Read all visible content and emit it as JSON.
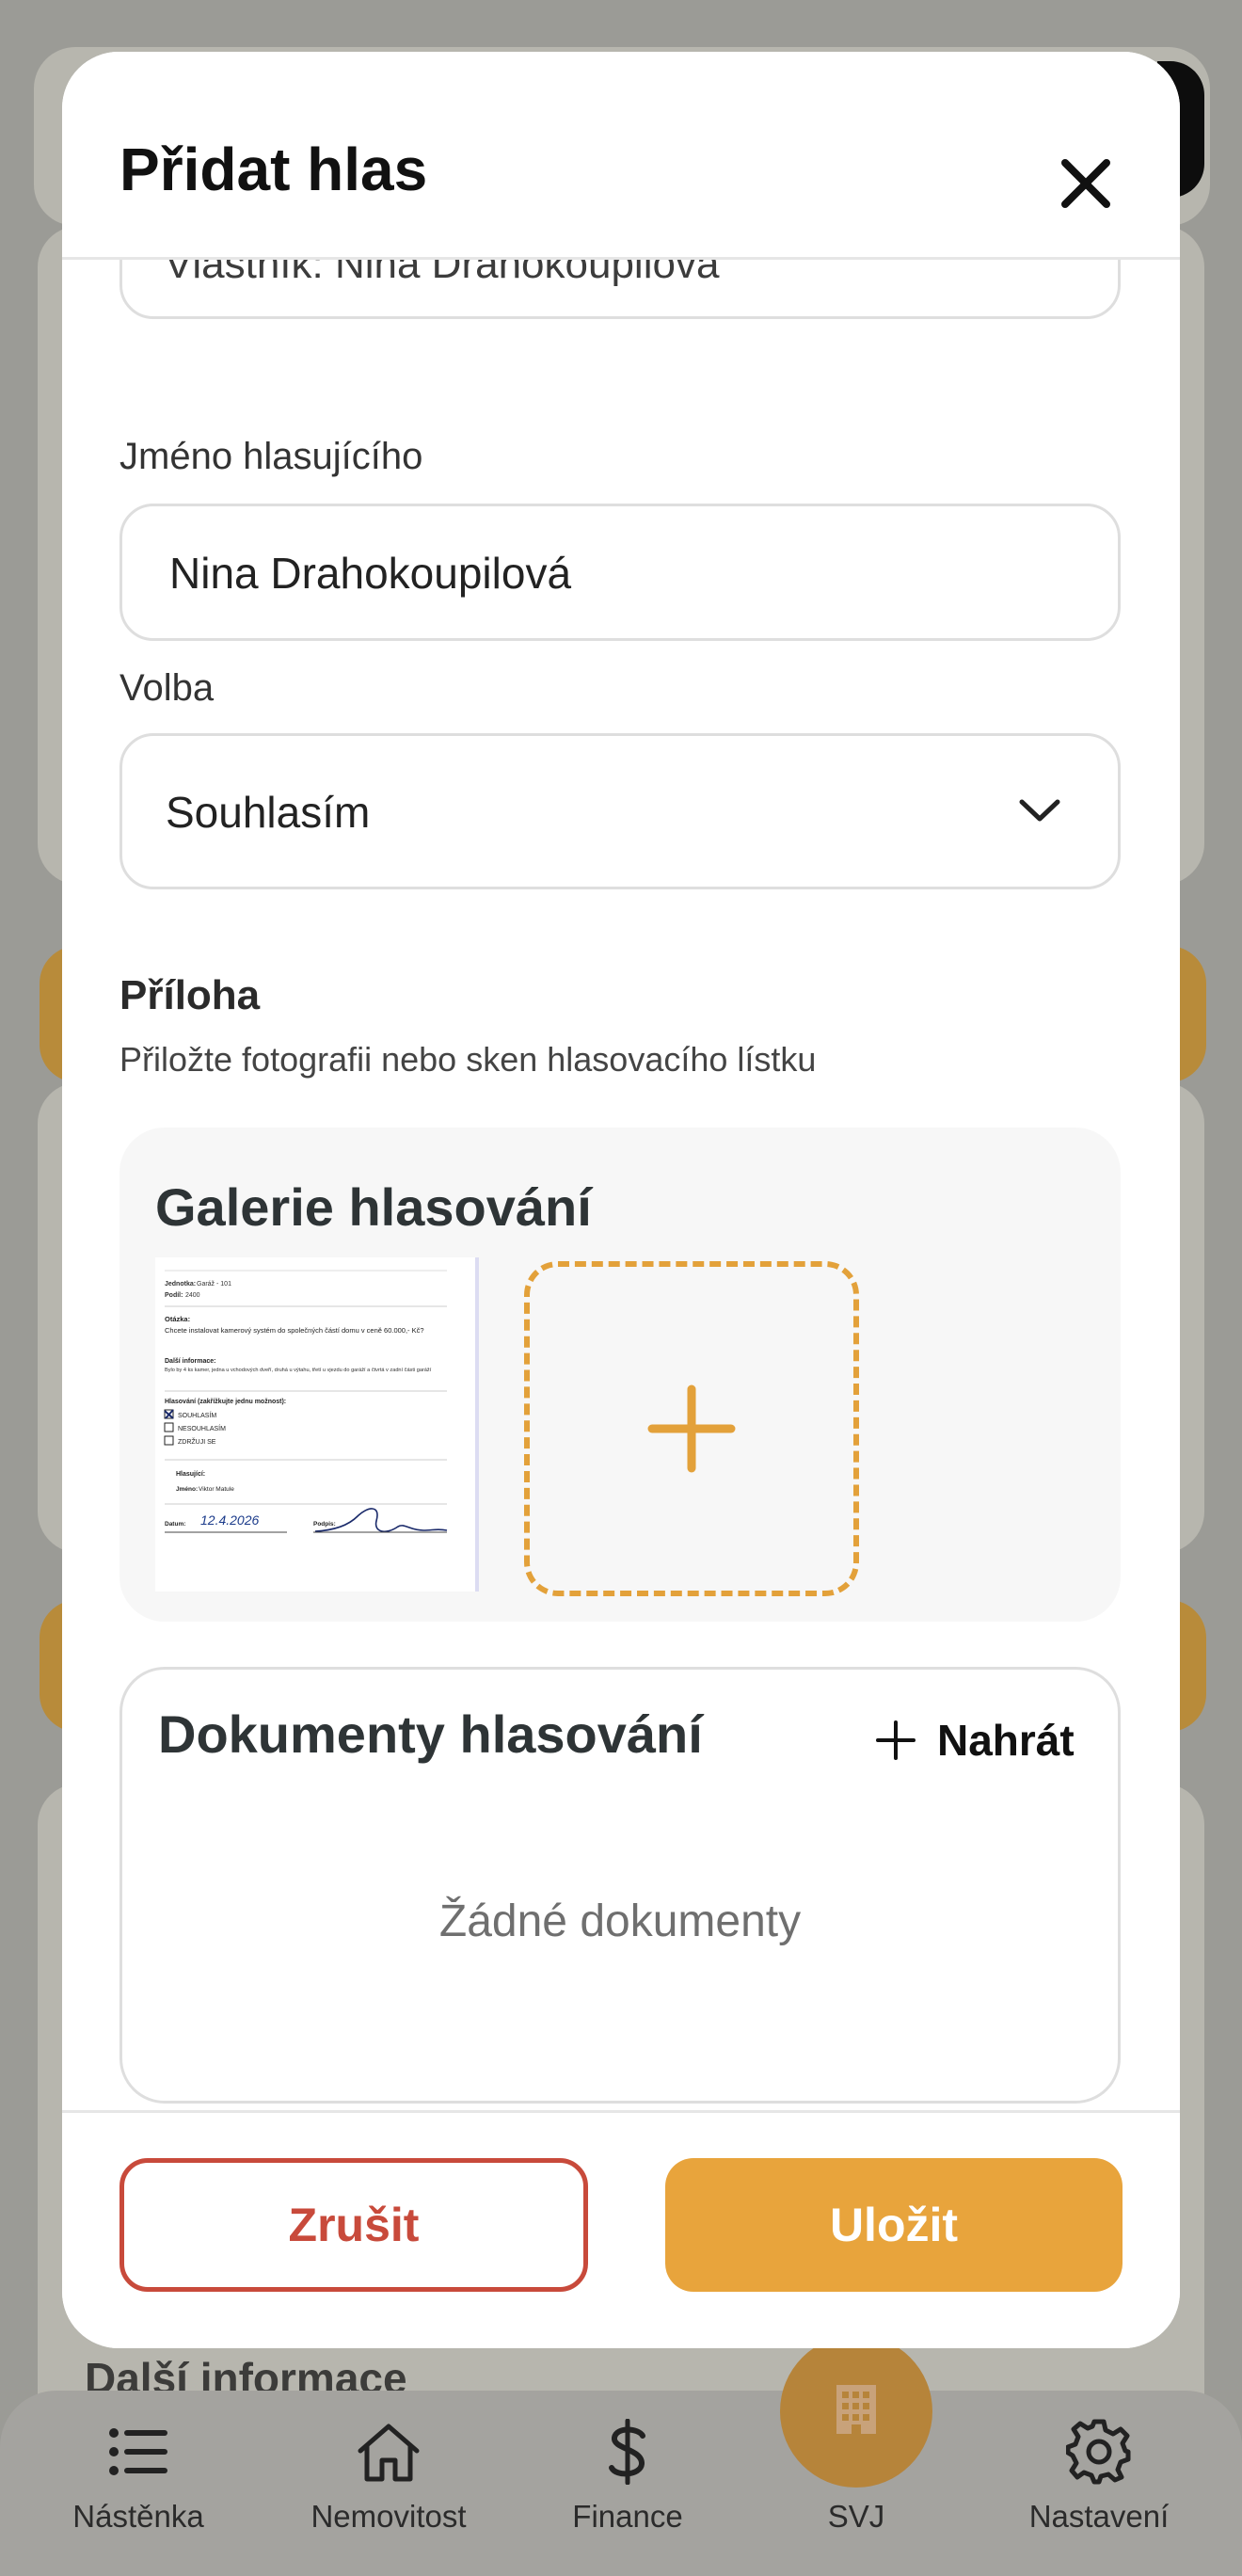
{
  "modal": {
    "title": "Přidat hlas",
    "owner_field_text": "Vlastník: Nina Drahokoupilová",
    "voter_name_label": "Jméno hlasujícího",
    "voter_name_value": "Nina Drahokoupilová",
    "choice_label": "Volba",
    "choice_selected": "Souhlasím",
    "attachment_title": "Příloha",
    "attachment_subtitle": "Přiložte fotografii nebo sken hlasovacího lístku",
    "gallery_title": "Galerie hlasování",
    "documents_title": "Dokumenty hlasování",
    "upload_label": "Nahrát",
    "documents_empty": "Žádné dokumenty",
    "cancel_label": "Zrušit",
    "save_label": "Uložit"
  },
  "ballot_thumbnail": {
    "unit_label": "Jednotka:",
    "unit_value": "Garáž - 101",
    "share_label": "Podíl:",
    "share_value": "2400",
    "question_label": "Otázka:",
    "question_text": "Chcete instalovat kamerový systém do společných částí domu v ceně 60.000,- Kč?",
    "info_label": "Další informace:",
    "info_text": "Bylo by 4 ks kamer, jedna u vchodových dveří, druhá u výtahu, třetí u vjezdu do garáží a čtvrtá v zadní části garáží",
    "voting_label": "Hlasování (zakřížkujte jednu možnost):",
    "options": [
      "SOUHLASÍM",
      "NESOUHLASÍM",
      "ZDRŽUJI SE"
    ],
    "checked_index": 0,
    "voter_label": "Hlasující:",
    "voter_name_label": "Jméno:",
    "voter_name": "Viktor Matule",
    "date_label": "Datum:",
    "date_value": "12.4.2026",
    "signature_label": "Podpis:"
  },
  "background": {
    "partial_heading": "Další informace"
  },
  "bottom_nav": {
    "items": [
      {
        "label": "Nástěnka",
        "icon": "list-icon"
      },
      {
        "label": "Nemovitost",
        "icon": "house-icon"
      },
      {
        "label": "Finance",
        "icon": "dollar-icon"
      },
      {
        "label": "SVJ",
        "icon": "building-icon"
      },
      {
        "label": "Nastavení",
        "icon": "gear-icon"
      }
    ]
  },
  "colors": {
    "accent": "#e8a43c",
    "danger": "#c84a3b",
    "overlay": "#9b9b96"
  }
}
